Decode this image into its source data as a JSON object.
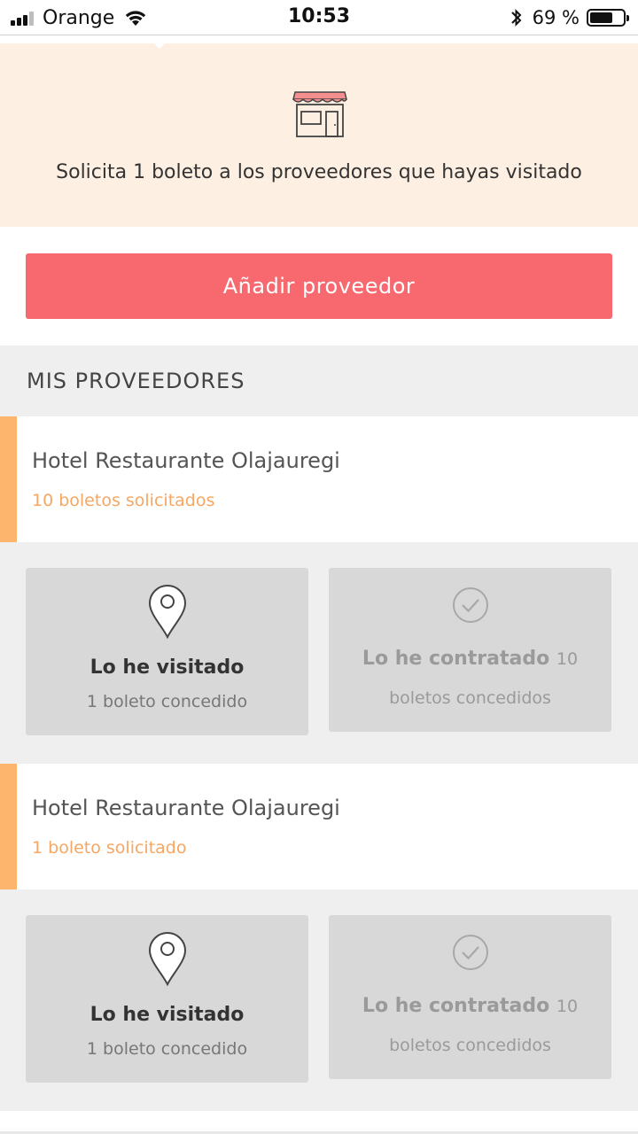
{
  "status_bar": {
    "carrier": "Orange",
    "time": "10:53",
    "battery": "69 %",
    "battery_level": 0.69
  },
  "banner": {
    "icon": "store-icon",
    "text": "Solicita 1 boleto a los proveedores que hayas visitado"
  },
  "add_button": {
    "label": "Añadir proveedor"
  },
  "section": {
    "title": "MIS PROVEEDORES"
  },
  "providers": [
    {
      "name": "Hotel Restaurante Olajauregi",
      "requested": "10 boletos solicitados",
      "visited": {
        "title": "Lo he visitado",
        "sub": "1 boleto concedido",
        "icon": "location-pin-icon"
      },
      "contracted": {
        "title": "Lo he contratado",
        "count": "10",
        "sub": "boletos concedidos",
        "icon": "check-circle-icon"
      }
    },
    {
      "name": "Hotel Restaurante Olajauregi",
      "requested": "1 boleto solicitado",
      "visited": {
        "title": "Lo he visitado",
        "sub": "1 boleto concedido",
        "icon": "location-pin-icon"
      },
      "contracted": {
        "title": "Lo he contratado",
        "count": "10",
        "sub": "boletos concedidos",
        "icon": "check-circle-icon"
      }
    }
  ],
  "colors": {
    "accent": "#f7686f",
    "banner_bg": "#fdf0e2",
    "provider_accent": "#fdb56e",
    "requested_text": "#f5a763"
  }
}
